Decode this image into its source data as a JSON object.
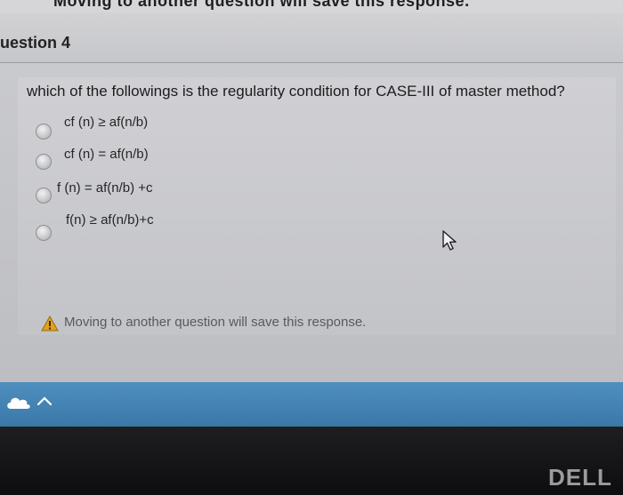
{
  "top_banner": {
    "text": "Moving to another question will save this response."
  },
  "question": {
    "title": "uestion 4",
    "prompt": "which of the followings is the regularity condition for CASE-III of master method?",
    "options": [
      {
        "label": "cf (n) ≥ af(n/b)"
      },
      {
        "label": "cf (n) = af(n/b)"
      },
      {
        "label": "f (n) = af(n/b) +c"
      },
      {
        "label": "f(n) ≥ af(n/b)+c"
      }
    ]
  },
  "notice": {
    "text": "Moving to another question will save this response."
  },
  "bezel": {
    "logo": "DELL"
  },
  "icons": {
    "cursor": "mouse-pointer-icon",
    "warning": "warning-icon",
    "taskbar": "cloud-icon",
    "chevron": "chevron-up-icon"
  },
  "colors": {
    "taskbar": "#4a88b8",
    "background": "#c9cacd",
    "bezel": "#141416"
  }
}
